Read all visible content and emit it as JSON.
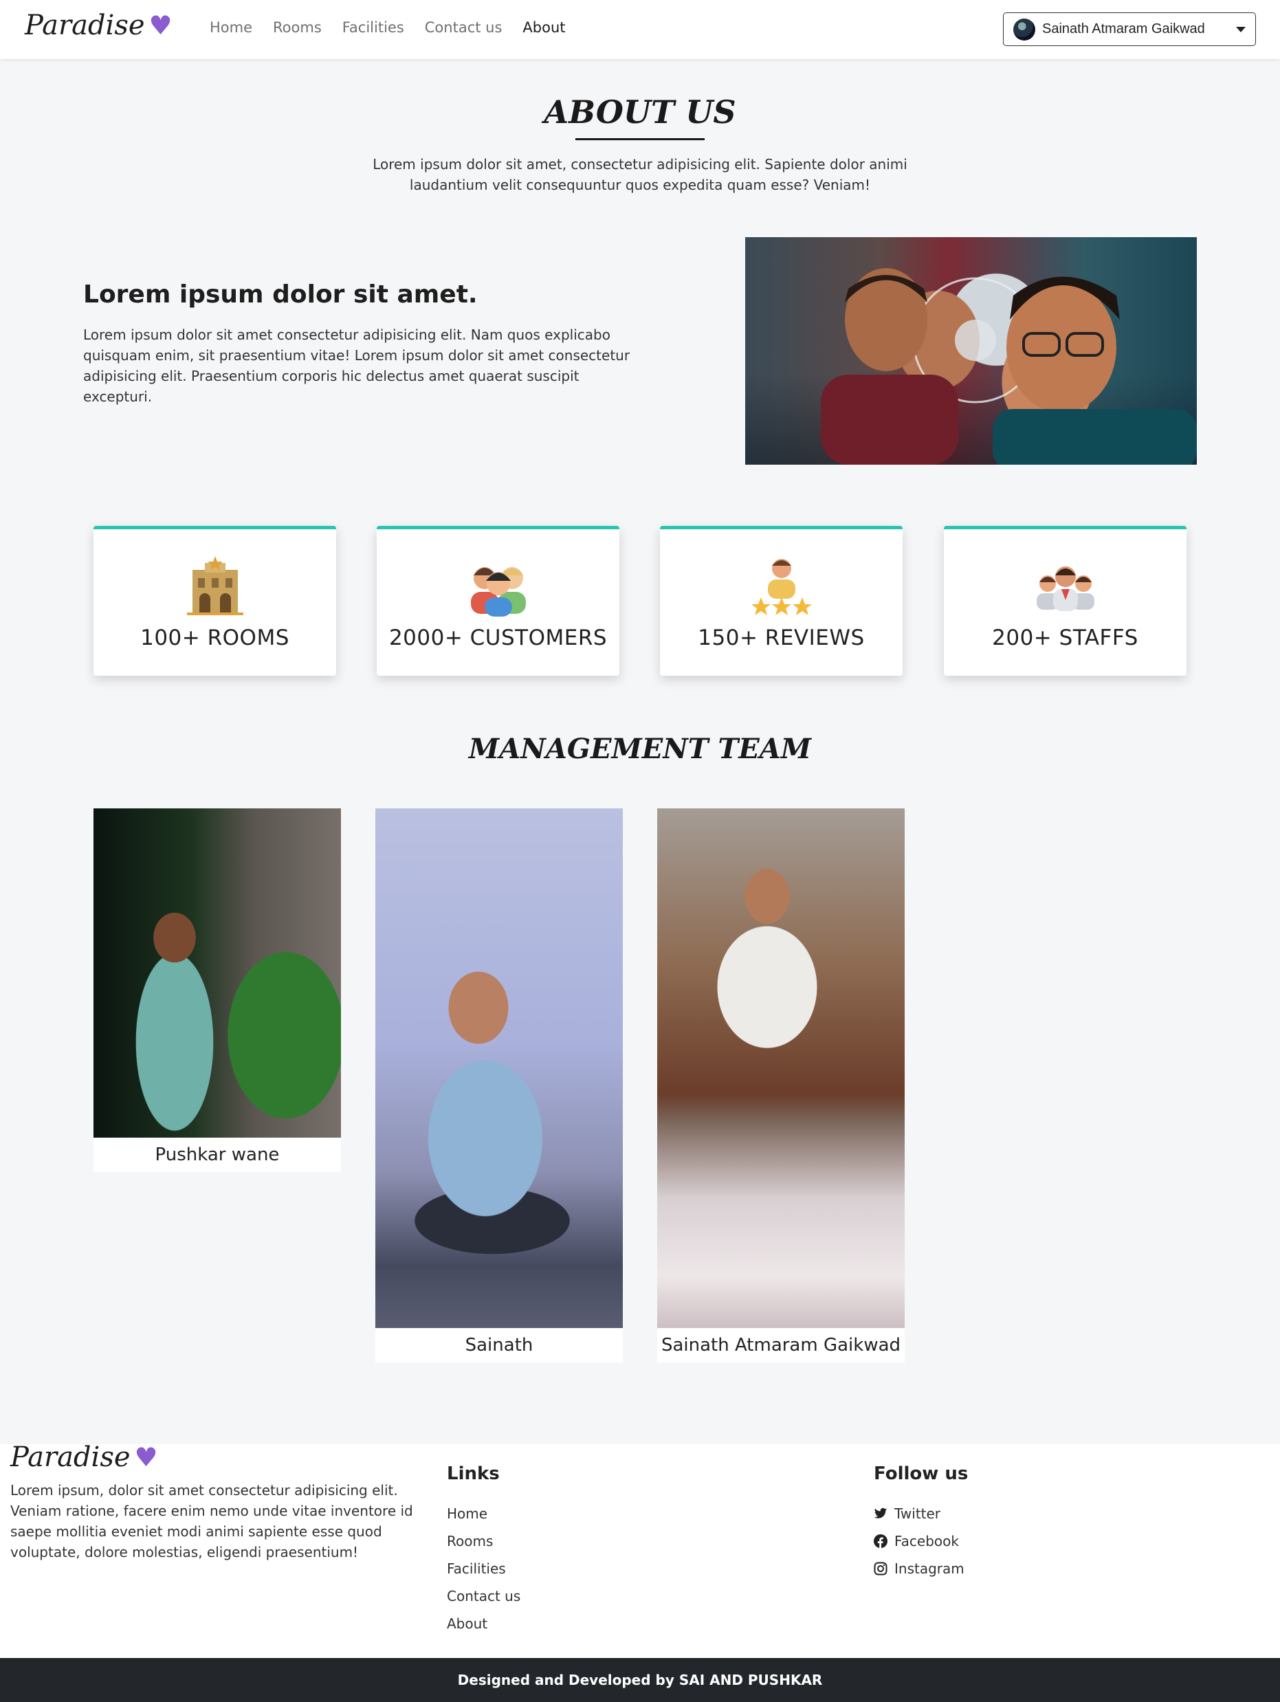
{
  "navbar": {
    "brand": "Paradise",
    "links": [
      "Home",
      "Rooms",
      "Facilities",
      "Contact us",
      "About"
    ],
    "active_link": "About",
    "user_name": "Sainath Atmaram Gaikwad"
  },
  "about": {
    "title": "ABOUT US",
    "lead": "Lorem ipsum dolor sit amet, consectetur adipisicing elit. Sapiente dolor animi laudantium velit consequuntur quos expedita quam esse? Veniam!",
    "intro_heading": "Lorem ipsum dolor sit amet.",
    "intro_text": "Lorem ipsum dolor sit amet consectetur adipisicing elit. Nam quos explicabo quisquam enim, sit praesentium vitae! Lorem ipsum dolor sit amet consectetur adipisicing elit. Praesentium corporis hic delectus amet quaerat suscipit excepturi."
  },
  "stats": [
    {
      "label": "100+ ROOMS",
      "icon": "hotel-building-icon"
    },
    {
      "label": "2000+ CUSTOMERS",
      "icon": "customers-group-icon"
    },
    {
      "label": "150+ REVIEWS",
      "icon": "reviewer-stars-icon"
    },
    {
      "label": "200+ STAFFS",
      "icon": "staff-team-icon"
    }
  ],
  "management": {
    "title": "MANAGEMENT TEAM",
    "members": [
      {
        "name": "Pushkar wane"
      },
      {
        "name": "Sainath"
      },
      {
        "name": "Sainath Atmaram Gaikwad"
      }
    ]
  },
  "footer": {
    "brand": "Paradise",
    "description": "Lorem ipsum, dolor sit amet consectetur adipisicing elit. Veniam ratione, facere enim nemo unde vitae inventore id saepe mollitia eveniet modi animi sapiente esse quod voluptate, dolore molestias, eligendi praesentium!",
    "links_heading": "Links",
    "links": [
      "Home",
      "Rooms",
      "Facilities",
      "Contact us",
      "About"
    ],
    "follow_heading": "Follow us",
    "social": [
      {
        "label": "Twitter",
        "icon": "twitter-icon"
      },
      {
        "label": "Facebook",
        "icon": "facebook-icon"
      },
      {
        "label": "Instagram",
        "icon": "instagram-icon"
      }
    ],
    "credit": "Designed and Developed by SAI AND PUSHKAR"
  },
  "colors": {
    "accent": "#2cc4b0",
    "heart": "#8a5cd0",
    "footer_bar": "#23262b"
  }
}
